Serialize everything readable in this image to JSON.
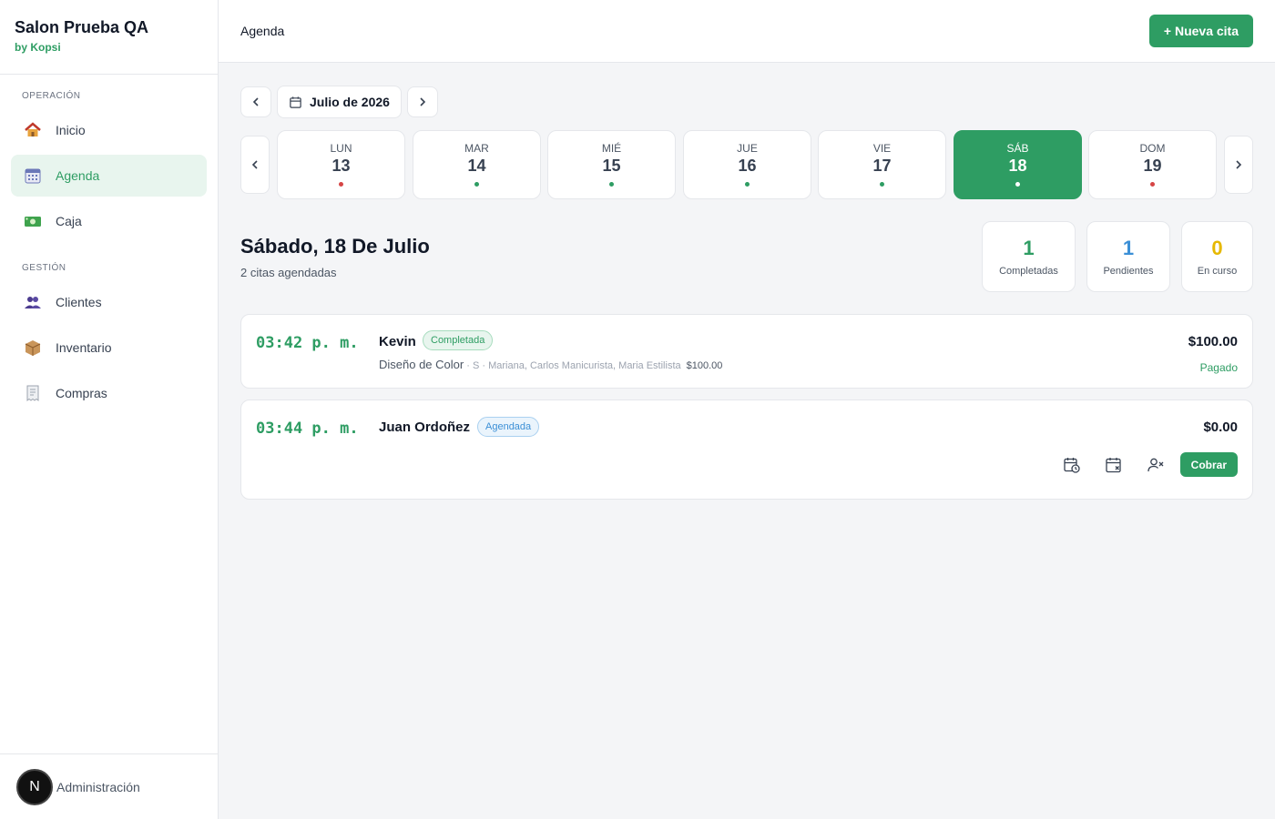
{
  "sidebar": {
    "brand_title": "Salon Prueba QA",
    "brand_sub": "by Kopsi",
    "section_operacion": "OPERACIÓN",
    "section_gestion": "GESTIÓN",
    "items": [
      {
        "label": "Inicio",
        "icon": "house-icon"
      },
      {
        "label": "Agenda",
        "icon": "calendar-icon",
        "active": true
      },
      {
        "label": "Caja",
        "icon": "money-icon"
      },
      {
        "label": "Clientes",
        "icon": "users-icon"
      },
      {
        "label": "Inventario",
        "icon": "package-icon"
      },
      {
        "label": "Compras",
        "icon": "receipt-icon"
      }
    ],
    "footer": {
      "avatar_letter": "N",
      "label": "Administración"
    }
  },
  "header": {
    "title": "Agenda",
    "new_button": "+ Nueva cita"
  },
  "month_nav": {
    "label": "Julio de 2026"
  },
  "week": [
    {
      "name": "LUN",
      "num": "13",
      "dot": "#d64545"
    },
    {
      "name": "MAR",
      "num": "14",
      "dot": "#2e9d63"
    },
    {
      "name": "MIÉ",
      "num": "15",
      "dot": "#2e9d63"
    },
    {
      "name": "JUE",
      "num": "16",
      "dot": "#2e9d63"
    },
    {
      "name": "VIE",
      "num": "17",
      "dot": "#2e9d63"
    },
    {
      "name": "SÁB",
      "num": "18",
      "dot": "#ffffff",
      "selected": true
    },
    {
      "name": "DOM",
      "num": "19",
      "dot": "#d64545"
    }
  ],
  "day": {
    "heading": "Sábado, 18 De Julio",
    "count": "2 citas agendadas"
  },
  "stats": [
    {
      "value": "1",
      "label": "Completadas",
      "color": "#2e9d63"
    },
    {
      "value": "1",
      "label": "Pendientes",
      "color": "#3b8fd6"
    },
    {
      "value": "0",
      "label": "En curso",
      "color": "#e6b800"
    }
  ],
  "appointments": [
    {
      "time": "03:42 p. m.",
      "client": "Kevin",
      "status_badge": "Completada",
      "service": "Diseño de Color",
      "staff": " · S · Mariana, Carlos Manicurista, Maria Estilista",
      "service_price": "$100.00",
      "amount": "$100.00",
      "payment_status": "Pagado"
    },
    {
      "time": "03:44 p. m.",
      "client": "Juan Ordoñez",
      "status_badge": "Agendada",
      "amount": "$0.00",
      "charge_button": "Cobrar"
    }
  ],
  "colors": {
    "accent": "#2e9d63",
    "accent_light": "#e8f5ee",
    "info": "#3b8fd6",
    "warning": "#e6b800",
    "danger": "#d64545"
  }
}
